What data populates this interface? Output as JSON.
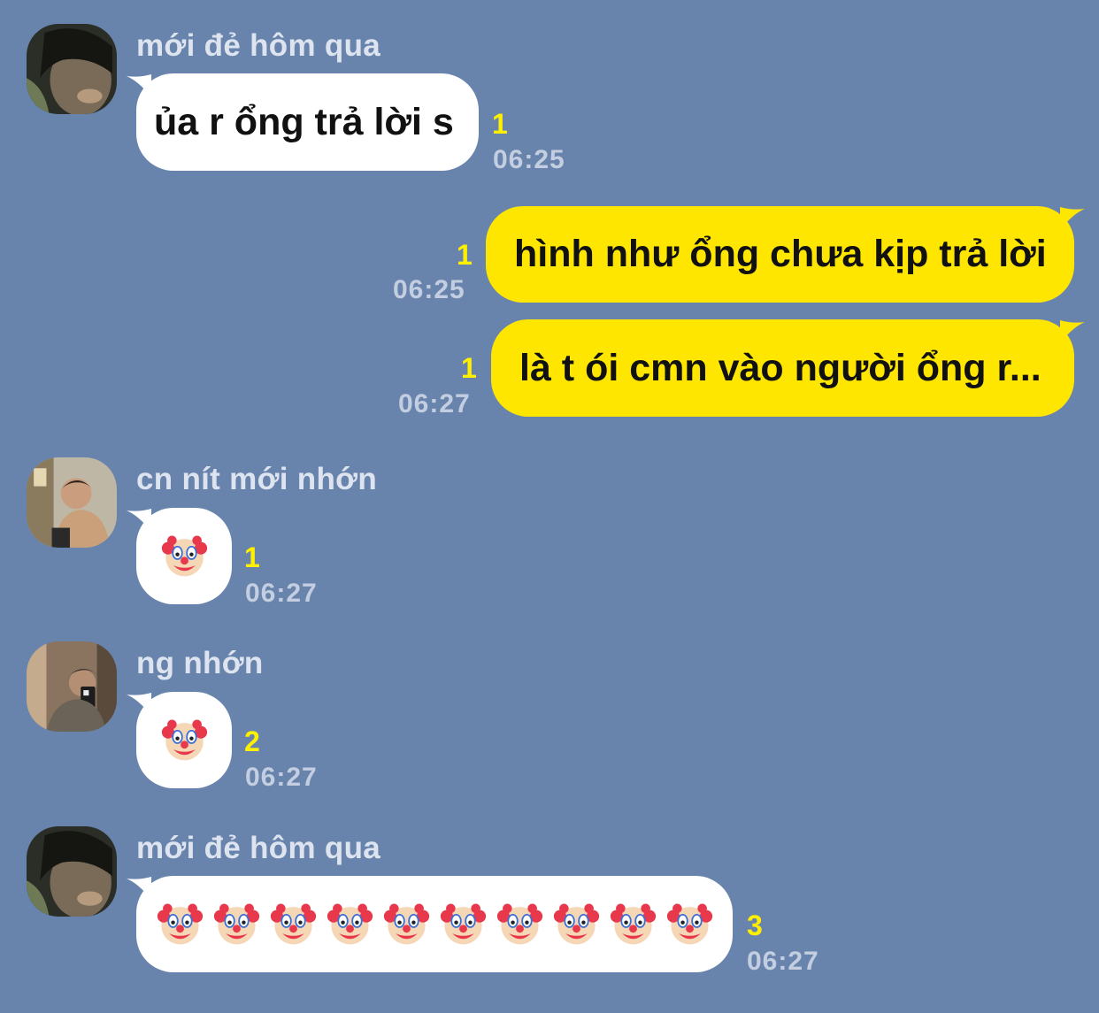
{
  "messages": [
    {
      "sender": "mới đẻ hôm qua",
      "text": "ủa r ổng trả lời s",
      "read": "1",
      "time": "06:25"
    },
    {
      "text": "hình như ổng chưa kịp trả lời",
      "read": "1",
      "time": "06:25"
    },
    {
      "text": "là t ói cmn vào người ổng r...",
      "read": "1",
      "time": "06:27"
    },
    {
      "sender": "cn nít mới nhớn",
      "emoji": "clown-face",
      "read": "1",
      "time": "06:27"
    },
    {
      "sender": "ng nhớn",
      "emoji": "clown-face",
      "read": "2",
      "time": "06:27"
    },
    {
      "sender": "mới đẻ hôm qua",
      "emoji": "clown-face",
      "emoji_count": 10,
      "read": "3",
      "time": "06:27"
    }
  ],
  "colors": {
    "background": "#6884ad",
    "incoming_bubble": "#ffffff",
    "outgoing_bubble": "#ffe600",
    "read_count": "#fff000",
    "timestamp": "#c3cee0",
    "sender_name": "#dde4ef"
  }
}
